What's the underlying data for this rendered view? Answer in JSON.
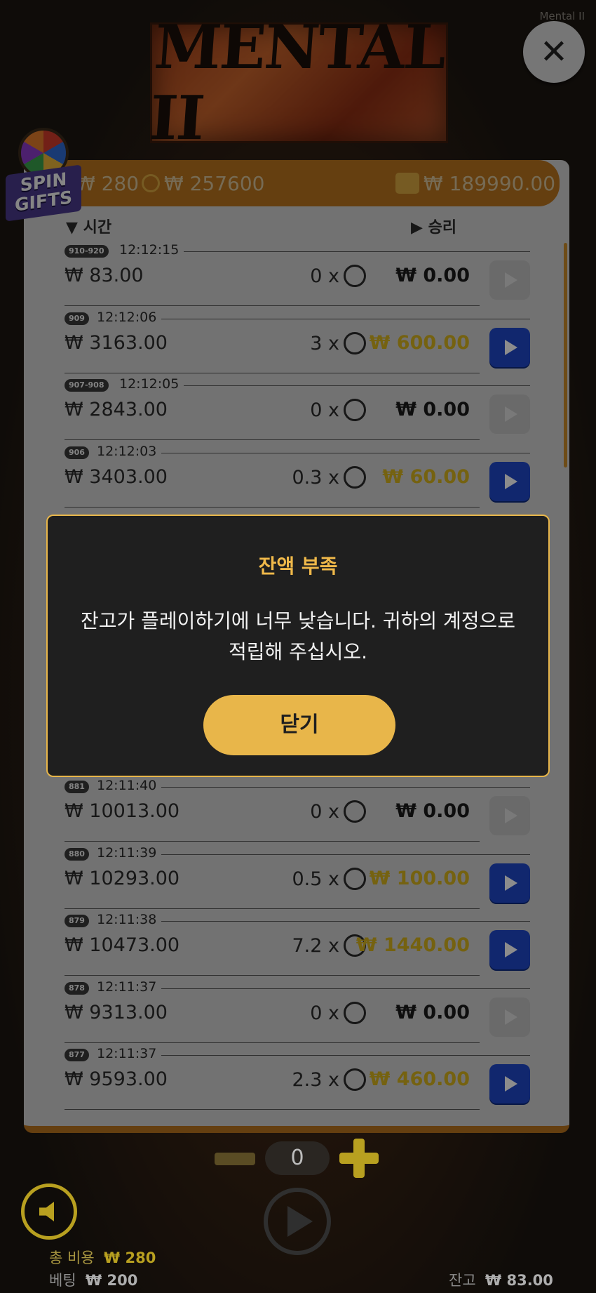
{
  "app": {
    "title": "Mental II",
    "logo_text": "MENTAL II"
  },
  "close_label": "✕",
  "spin_gifts": "SPIN GIFTS",
  "header": {
    "bet": "₩ 280",
    "coin_total": "₩ 257600",
    "wallet": "₩ 189990.00"
  },
  "columns": {
    "time": "시간",
    "win": "승리"
  },
  "rows": [
    {
      "tag": "910-920",
      "time": "12:12:15",
      "amount": "₩ 83.00",
      "mult": "0 x",
      "win": "₩ 0.00",
      "won": false
    },
    {
      "tag": "909",
      "time": "12:12:06",
      "amount": "₩ 3163.00",
      "mult": "3 x",
      "win": "₩ 600.00",
      "won": true
    },
    {
      "tag": "907-908",
      "time": "12:12:05",
      "amount": "₩ 2843.00",
      "mult": "0 x",
      "win": "₩ 0.00",
      "won": false
    },
    {
      "tag": "906",
      "time": "12:12:03",
      "amount": "₩ 3403.00",
      "mult": "0.3 x",
      "win": "₩ 60.00",
      "won": true
    },
    {
      "tag": "881",
      "time": "12:11:40",
      "amount": "₩ 10013.00",
      "mult": "0 x",
      "win": "₩ 0.00",
      "won": false
    },
    {
      "tag": "880",
      "time": "12:11:39",
      "amount": "₩ 10293.00",
      "mult": "0.5 x",
      "win": "₩ 100.00",
      "won": true
    },
    {
      "tag": "879",
      "time": "12:11:38",
      "amount": "₩ 10473.00",
      "mult": "7.2 x",
      "win": "₩ 1440.00",
      "won": true
    },
    {
      "tag": "878",
      "time": "12:11:37",
      "amount": "₩ 9313.00",
      "mult": "0 x",
      "win": "₩ 0.00",
      "won": false
    },
    {
      "tag": "877",
      "time": "12:11:37",
      "amount": "₩ 9593.00",
      "mult": "2.3 x",
      "win": "₩ 460.00",
      "won": true
    }
  ],
  "dialog": {
    "title": "잔액 부족",
    "message": "잔고가 플레이하기에 너무 낮습니다. 귀하의 계정으로 적립해 주십시오.",
    "button": "닫기"
  },
  "bottom": {
    "counter": "0",
    "total_cost_label": "총 비용",
    "total_cost_value": "₩ 280",
    "bet_label": "베팅",
    "bet_value": "₩ 200",
    "balance_label": "잔고",
    "balance_value": "₩ 83.00"
  },
  "colors": {
    "accent": "#e8b64a",
    "panel": "#cfcfcf",
    "play_active": "#1f48c8"
  }
}
